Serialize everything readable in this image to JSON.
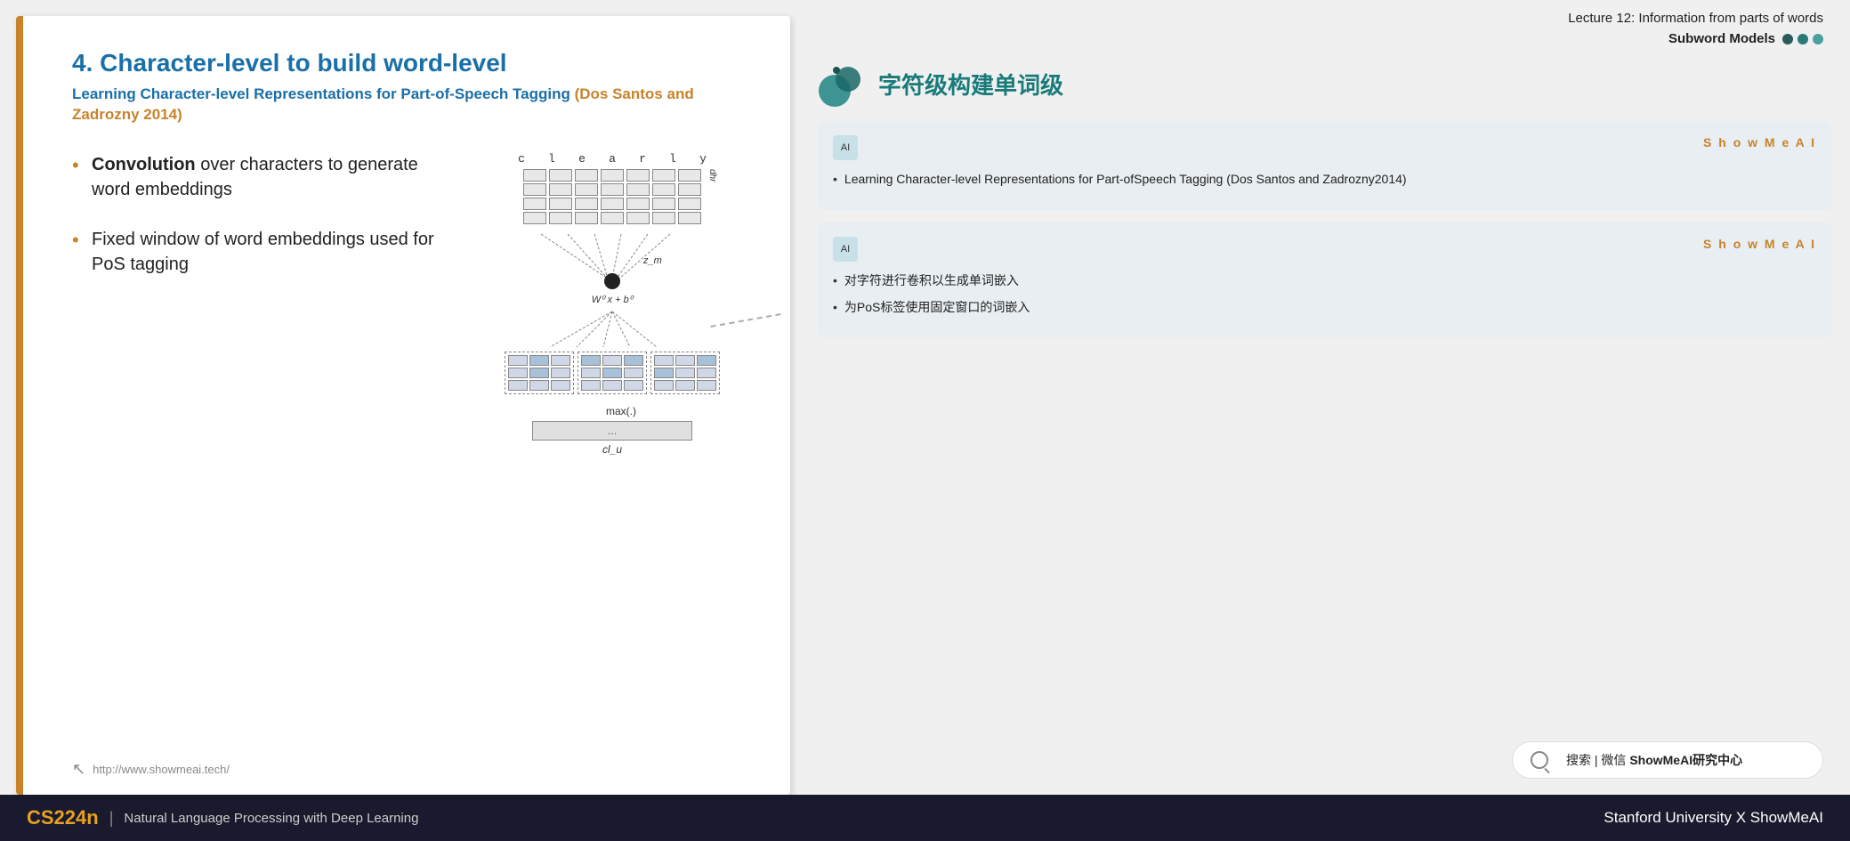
{
  "lecture": {
    "line1": "Lecture 12: Information from parts of words",
    "line2": "Subword Models"
  },
  "section": {
    "title_zh": "字符级构建单词级"
  },
  "slide": {
    "title": "4. Character-level to build word-level",
    "subtitle_main": "Learning Character-level Representations for Part-of-Speech Tagging",
    "subtitle_authors": " (Dos Santos and Zadrozny 2014)",
    "bullet1_bold": "Convolution",
    "bullet1_rest": " over characters to generate word embeddings",
    "bullet2": "Fixed window of word embeddings used for PoS tagging",
    "footer_url": "http://www.showmeai.tech/",
    "chars": [
      "c",
      "l",
      "e",
      "a",
      "r",
      "l",
      "y"
    ],
    "dhr": "dhr",
    "zm_label": "z_m",
    "formula": "W⁰ x  + b⁰",
    "max_label": "max(.)",
    "clu_label": "cl_u"
  },
  "card1": {
    "brand": "S h o w M e A I",
    "text": "Learning Character-level Representations for Part-ofSpeech Tagging (Dos Santos and Zadrozny2014)"
  },
  "card2": {
    "brand": "S h o w M e A I",
    "bullet1": "对字符进行卷积以生成单词嵌入",
    "bullet2": "为PoS标签使用固定窗口的词嵌入"
  },
  "search": {
    "icon_label": "search",
    "text": "搜索 | 微信 ",
    "brand": "ShowMeAI研究中心"
  },
  "footer": {
    "cs224n": "CS224n",
    "divider": "|",
    "subtitle": "Natural Language Processing with Deep Learning",
    "right": "Stanford University X ShowMeAI"
  },
  "icons": {
    "ai_icon": "AI",
    "cursor_icon": "↖",
    "search_icon": "🔍"
  }
}
